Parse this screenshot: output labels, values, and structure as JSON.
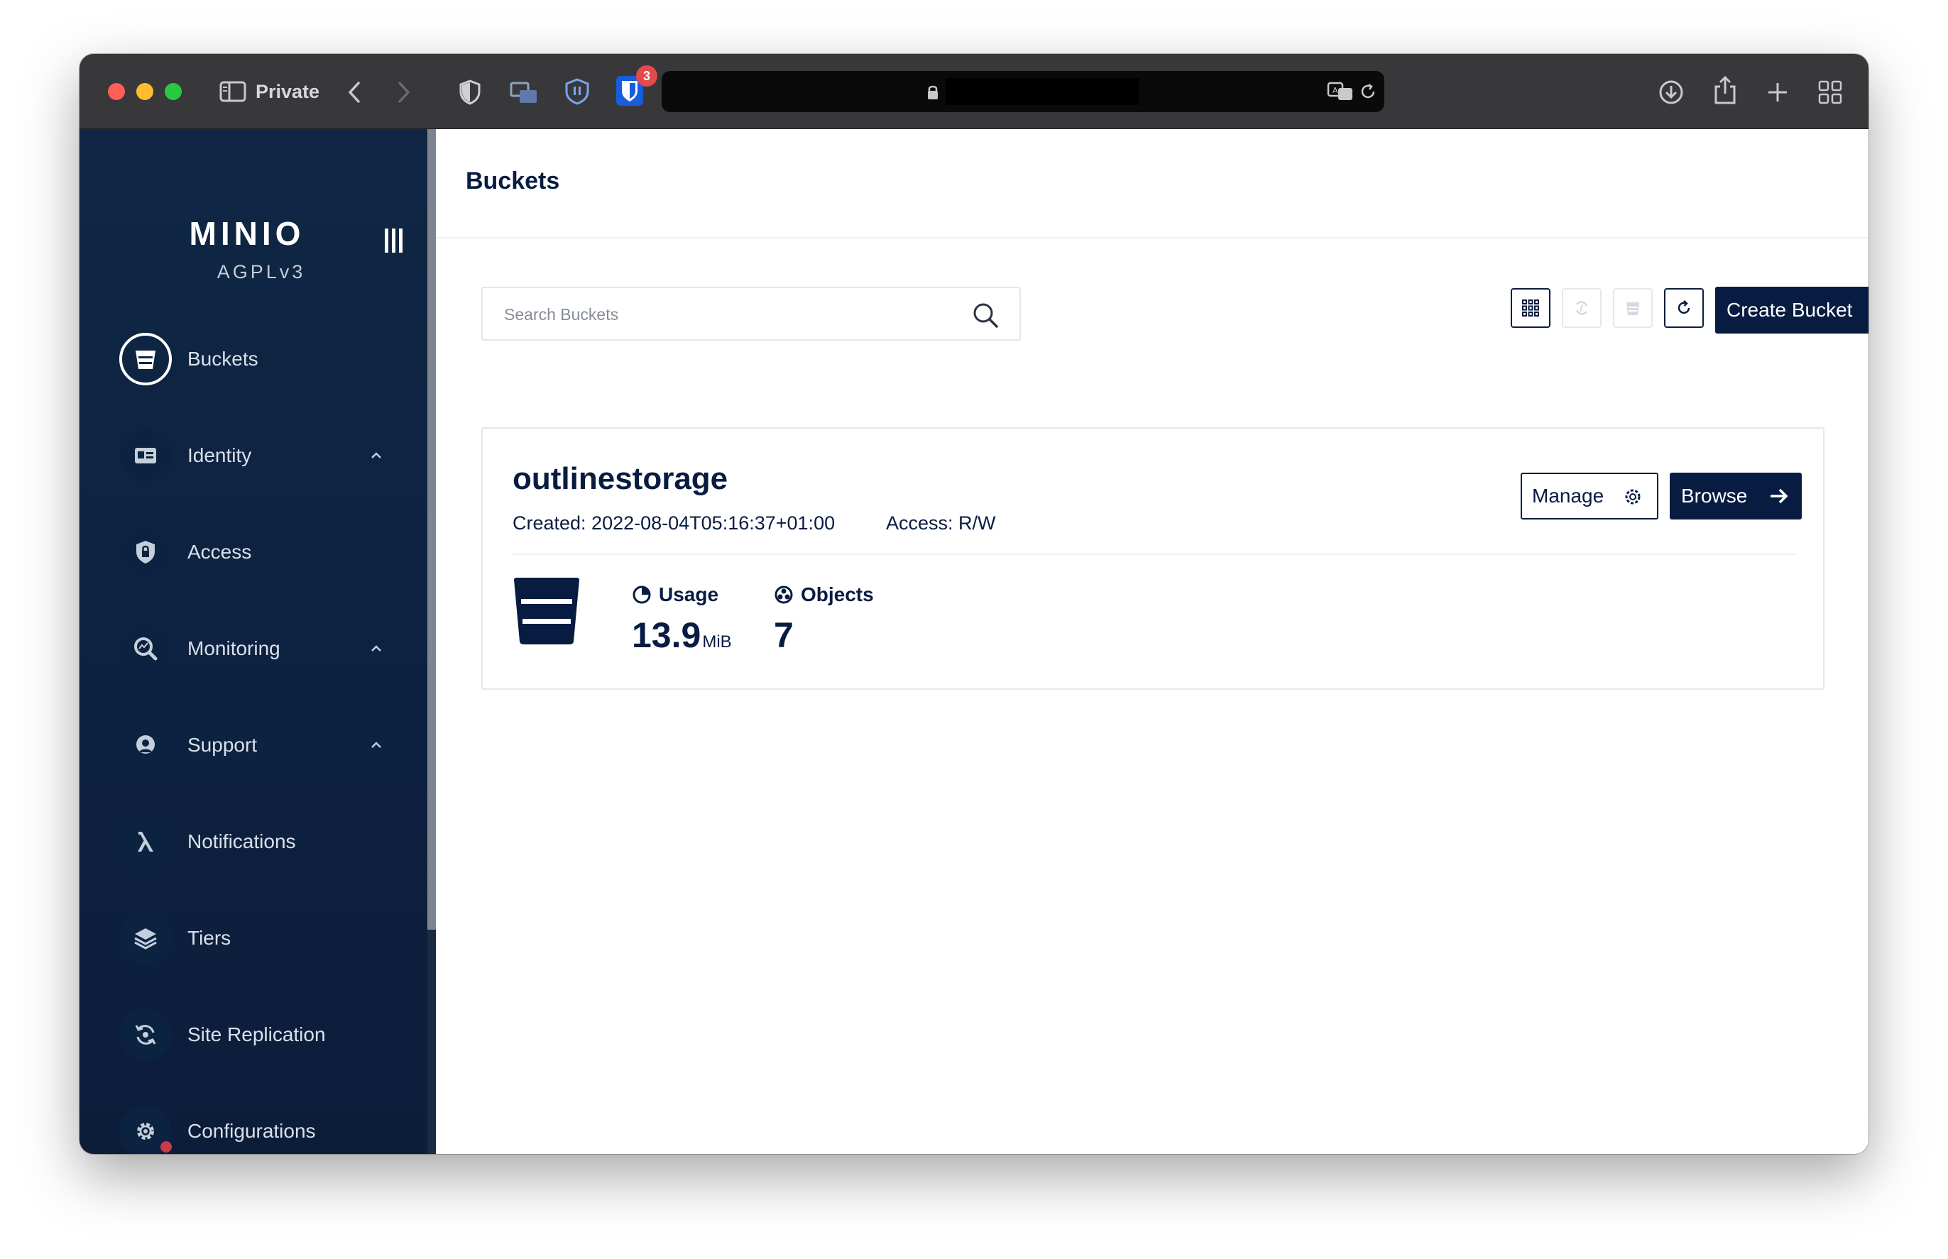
{
  "browser": {
    "private_label": "Private",
    "extension_badge_count": "3",
    "icons": [
      "sidebar-toggle-icon",
      "back-icon",
      "forward-icon",
      "shield-icon",
      "screens-icon",
      "vpn-shield-icon",
      "bitwarden-icon",
      "lock-icon",
      "translate-icon",
      "reload-icon",
      "download-icon",
      "share-icon",
      "new-tab-icon",
      "tab-overview-icon"
    ]
  },
  "sidebar": {
    "logo": "MINIO",
    "license": "AGPLv3",
    "items": [
      {
        "label": "Buckets",
        "icon": "bucket-icon",
        "active": true
      },
      {
        "label": "Identity",
        "icon": "id-card-icon",
        "expandable": true
      },
      {
        "label": "Access",
        "icon": "lock-shield-icon"
      },
      {
        "label": "Monitoring",
        "icon": "magnifier-chart-icon",
        "expandable": true
      },
      {
        "label": "Support",
        "icon": "support-icon",
        "expandable": true
      },
      {
        "label": "Notifications",
        "icon": "lambda-icon"
      },
      {
        "label": "Tiers",
        "icon": "layers-icon"
      },
      {
        "label": "Site Replication",
        "icon": "replication-icon"
      },
      {
        "label": "Configurations",
        "icon": "gear-icon"
      }
    ]
  },
  "header": {
    "title": "Buckets"
  },
  "search": {
    "placeholder": "Search Buckets",
    "value": ""
  },
  "toolbar": {
    "create_label": "Create Bucket"
  },
  "buckets": [
    {
      "name": "outlinestorage",
      "created": "Created: 2022-08-04T05:16:37+01:00",
      "access": "Access: R/W",
      "manage_label": "Manage",
      "browse_label": "Browse",
      "usage_label": "Usage",
      "usage_value": "13.9",
      "usage_unit": "MiB",
      "objects_label": "Objects",
      "objects_value": "7"
    }
  ],
  "colors": {
    "sidebar": "#0f2744",
    "primary": "#081c42",
    "accent_red": "#c83b4b"
  }
}
